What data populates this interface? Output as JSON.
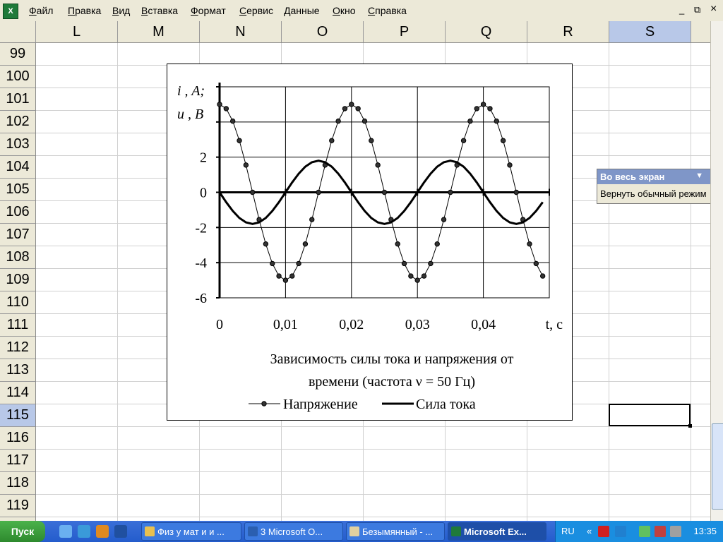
{
  "menubar": {
    "app_icon": "excel-app-icon",
    "items": [
      "Файл",
      "Правка",
      "Вид",
      "Вставка",
      "Формат",
      "Сервис",
      "Данные",
      "Окно",
      "Справка"
    ],
    "minimize": "_",
    "restore": "⧉",
    "close": "×"
  },
  "columns": [
    "L",
    "M",
    "N",
    "O",
    "P",
    "Q",
    "R",
    "S"
  ],
  "selected_column": "S",
  "rows": [
    "99",
    "100",
    "101",
    "102",
    "103",
    "104",
    "105",
    "106",
    "107",
    "108",
    "109",
    "110",
    "111",
    "112",
    "113",
    "114",
    "115",
    "116",
    "117",
    "118",
    "119"
  ],
  "selected_row": "115",
  "chart_data": {
    "type": "line",
    "title": "Зависимость силы тока и напряжения от времени (частота ν = 50 Гц)",
    "title_lines": [
      "Зависимость силы тока и напряжения от",
      "времени (частота ν = 50 Гц)"
    ],
    "ylabel_lines": [
      "i , A;",
      "u , B"
    ],
    "xlabel": "t, c",
    "xlim": [
      0,
      0.05
    ],
    "ylim": [
      -6,
      6
    ],
    "y_ticks": [
      "2",
      "0",
      "-2",
      "-4",
      "-6"
    ],
    "x_ticks": [
      "0",
      "0,01",
      "0,02",
      "0,03",
      "0,04"
    ],
    "grid": true,
    "legend_position": "bottom",
    "series": [
      {
        "name": "Напряжение",
        "marker": "circle",
        "x": [
          0,
          0.001,
          0.002,
          0.003,
          0.004,
          0.005,
          0.006,
          0.007,
          0.008,
          0.009,
          0.01,
          0.011,
          0.012,
          0.013,
          0.014,
          0.015,
          0.016,
          0.017,
          0.018,
          0.019,
          0.02,
          0.021,
          0.022,
          0.023,
          0.024,
          0.025,
          0.026,
          0.027,
          0.028,
          0.029,
          0.03,
          0.031,
          0.032,
          0.033,
          0.034,
          0.035,
          0.036,
          0.037,
          0.038,
          0.039,
          0.04,
          0.041,
          0.042,
          0.043,
          0.044,
          0.045,
          0.046,
          0.047,
          0.048,
          0.049
        ],
        "values": [
          5,
          4.76,
          4.05,
          2.94,
          1.55,
          0,
          -1.55,
          -2.94,
          -4.05,
          -4.76,
          -5,
          -4.76,
          -4.05,
          -2.94,
          -1.55,
          0,
          1.55,
          2.94,
          4.05,
          4.76,
          5,
          4.76,
          4.05,
          2.94,
          1.55,
          0,
          -1.55,
          -2.94,
          -4.05,
          -4.76,
          -5,
          -4.76,
          -4.05,
          -2.94,
          -1.55,
          0,
          1.55,
          2.94,
          4.05,
          4.76,
          5,
          4.76,
          4.05,
          2.94,
          1.55,
          0,
          -1.55,
          -2.94,
          -4.05,
          -4.76
        ]
      },
      {
        "name": "Сила тока",
        "marker": "none",
        "x": [
          0,
          0.001,
          0.002,
          0.003,
          0.004,
          0.005,
          0.006,
          0.007,
          0.008,
          0.009,
          0.01,
          0.011,
          0.012,
          0.013,
          0.014,
          0.015,
          0.016,
          0.017,
          0.018,
          0.019,
          0.02,
          0.021,
          0.022,
          0.023,
          0.024,
          0.025,
          0.026,
          0.027,
          0.028,
          0.029,
          0.03,
          0.031,
          0.032,
          0.033,
          0.034,
          0.035,
          0.036,
          0.037,
          0.038,
          0.039,
          0.04,
          0.041,
          0.042,
          0.043,
          0.044,
          0.045,
          0.046,
          0.047,
          0.048,
          0.049
        ],
        "values": [
          0,
          -0.56,
          -1.06,
          -1.46,
          -1.71,
          -1.8,
          -1.71,
          -1.46,
          -1.06,
          -0.56,
          0,
          0.56,
          1.06,
          1.46,
          1.71,
          1.8,
          1.71,
          1.46,
          1.06,
          0.56,
          0,
          -0.56,
          -1.06,
          -1.46,
          -1.71,
          -1.8,
          -1.71,
          -1.46,
          -1.06,
          -0.56,
          0,
          0.56,
          1.06,
          1.46,
          1.71,
          1.8,
          1.71,
          1.46,
          1.06,
          0.56,
          0,
          -0.56,
          -1.06,
          -1.46,
          -1.71,
          -1.8,
          -1.71,
          -1.46,
          -1.06,
          -0.56
        ]
      }
    ]
  },
  "fullscreen_toolbar": {
    "title": "Во весь экран",
    "button": "Вернуть обычный режим"
  },
  "taskbar": {
    "start_label": "Пуск",
    "tasks": [
      "Физ у мат и и ...",
      "3 Microsoft O...",
      "Безымянный - ...",
      "Microsoft Ex..."
    ],
    "active_task": "Microsoft Ex...",
    "lang": "RU",
    "tray_chevron": "«",
    "clock": "13:35"
  }
}
